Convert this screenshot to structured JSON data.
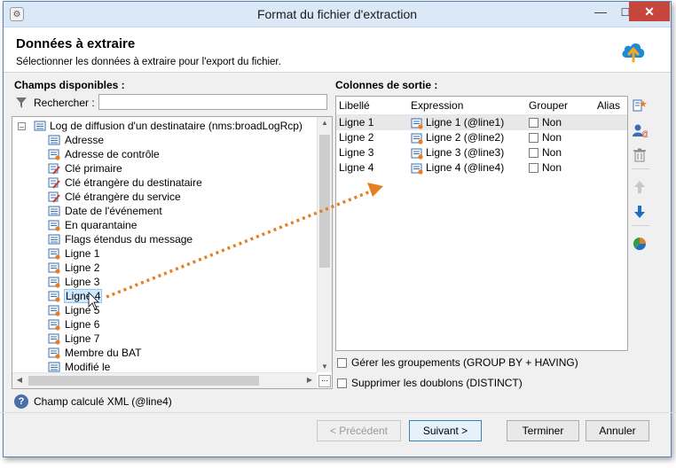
{
  "window": {
    "title": "Format du fichier d'extraction",
    "min_label": "—",
    "max_label": "☐",
    "close_label": "✕"
  },
  "header": {
    "title": "Données à extraire",
    "subtitle": "Sélectionner les données à extraire pour l'export du fichier.",
    "icon": "cloud-upload-icon"
  },
  "left": {
    "label": "Champs disponibles :",
    "search_label": "Rechercher :",
    "search_value": "",
    "root": "Log de diffusion d'un destinataire (nms:broadLogRcp)",
    "items": [
      {
        "label": "Adresse",
        "icon": "field-icon"
      },
      {
        "label": "Adresse de contrôle",
        "icon": "field-computed-icon"
      },
      {
        "label": "Clé primaire",
        "icon": "key-icon"
      },
      {
        "label": "Clé étrangère du destinataire",
        "icon": "key-icon"
      },
      {
        "label": "Clé étrangère du service",
        "icon": "key-icon"
      },
      {
        "label": "Date de l'événement",
        "icon": "field-icon"
      },
      {
        "label": "En quarantaine",
        "icon": "field-computed-icon"
      },
      {
        "label": "Flags étendus du message",
        "icon": "field-icon"
      },
      {
        "label": "Ligne 1",
        "icon": "field-computed-icon"
      },
      {
        "label": "Ligne 2",
        "icon": "field-computed-icon"
      },
      {
        "label": "Ligne 3",
        "icon": "field-computed-icon"
      },
      {
        "label": "Ligne 4",
        "icon": "field-computed-icon",
        "selected": true
      },
      {
        "label": "Ligne 5",
        "icon": "field-computed-icon"
      },
      {
        "label": "Ligne 6",
        "icon": "field-computed-icon"
      },
      {
        "label": "Ligne 7",
        "icon": "field-computed-icon"
      },
      {
        "label": "Membre du BAT",
        "icon": "field-computed-icon"
      },
      {
        "label": "Modifié le",
        "icon": "field-icon"
      }
    ]
  },
  "right": {
    "label": "Colonnes de sortie :",
    "columns": [
      "Libellé",
      "Expression",
      "Grouper",
      "Alias"
    ],
    "rows": [
      {
        "libelle": "Ligne 1",
        "expression": "Ligne 1 (@line1)",
        "grouper": "Non",
        "alias": ""
      },
      {
        "libelle": "Ligne 2",
        "expression": "Ligne 2 (@line2)",
        "grouper": "Non",
        "alias": ""
      },
      {
        "libelle": "Ligne 3",
        "expression": "Ligne 3 (@line3)",
        "grouper": "Non",
        "alias": ""
      },
      {
        "libelle": "Ligne 4",
        "expression": "Ligne 4 (@line4)",
        "grouper": "Non",
        "alias": ""
      }
    ],
    "tools": [
      "add-column-icon",
      "add-alias-icon",
      "delete-icon",
      "move-up-icon",
      "move-down-icon",
      "distribution-icon"
    ]
  },
  "options": {
    "group_by": "Gérer les groupements (GROUP BY + HAVING)",
    "distinct": "Supprimer les doublons (DISTINCT)"
  },
  "status": {
    "text": "Champ calculé XML (@line4)"
  },
  "buttons": {
    "previous": "< Précédent",
    "next": "Suivant >",
    "finish": "Terminer",
    "cancel": "Annuler"
  },
  "colors": {
    "accent": "#e67e22",
    "selection": "#cde8ff",
    "title_bar": "#dbe8f7",
    "close": "#c7463b"
  }
}
